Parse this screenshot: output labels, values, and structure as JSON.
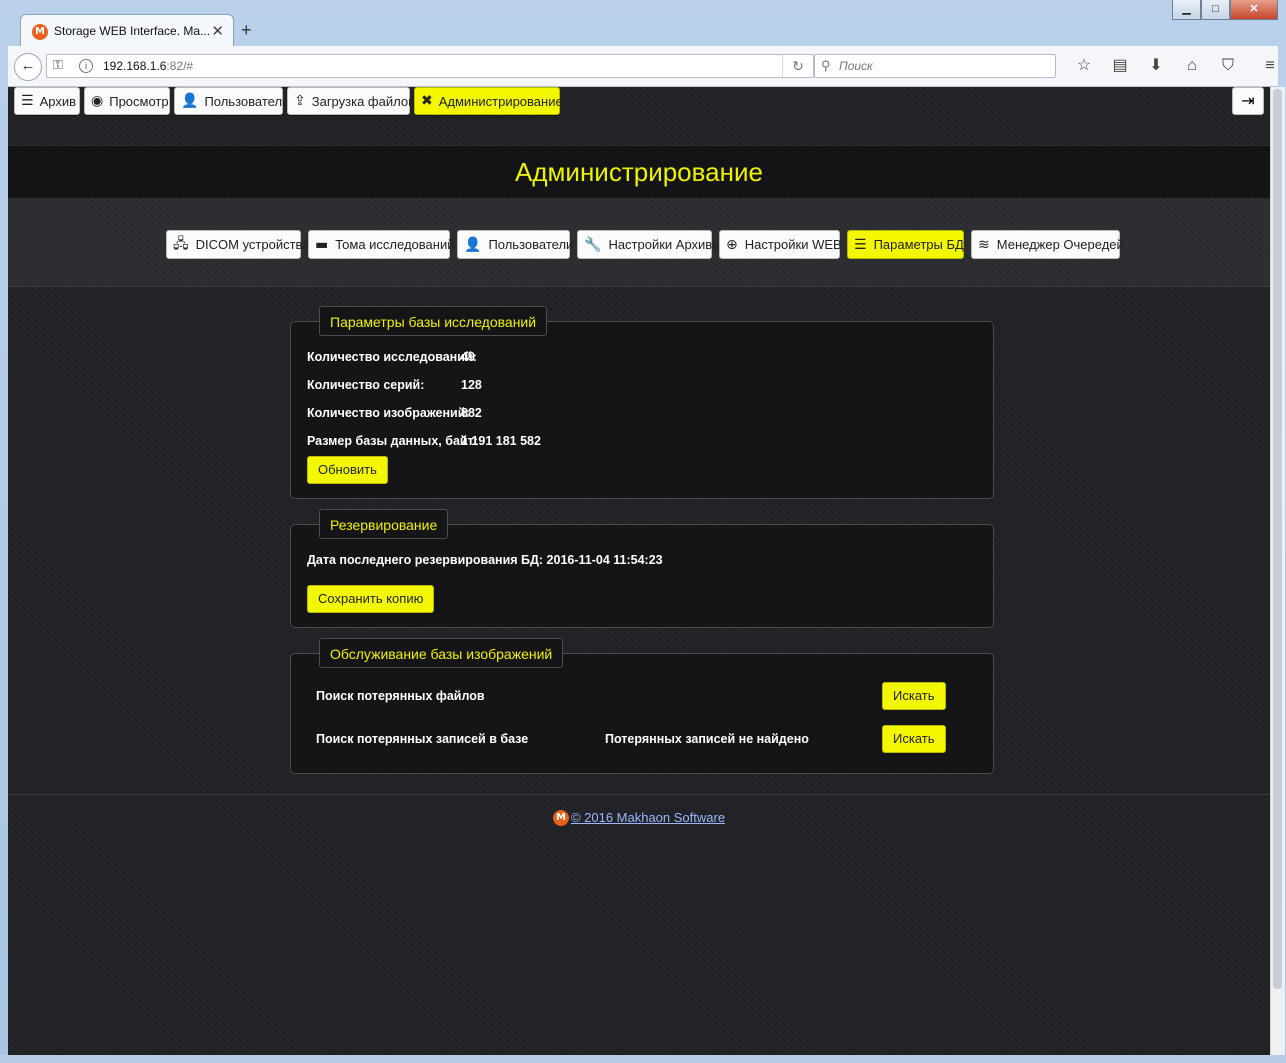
{
  "browser": {
    "tab_title": "Storage WEB Interface. Ma...",
    "tab_favicon": "М",
    "url_host": "192.168.1.6",
    "url_rest": ":82/#",
    "search_placeholder": "Поиск"
  },
  "top_nav": {
    "items": [
      {
        "label": "Архив",
        "icon": "list-icon",
        "glyph": "☰"
      },
      {
        "label": "Просмотр",
        "icon": "eye-icon",
        "glyph": "◉"
      },
      {
        "label": "Пользователь",
        "icon": "user-icon",
        "glyph": "👤"
      },
      {
        "label": "Загрузка файлов",
        "icon": "upload-icon",
        "glyph": "⇪"
      },
      {
        "label": "Администрирование",
        "icon": "tools-icon",
        "glyph": "✖"
      }
    ],
    "active": "Администрирование",
    "logout_icon": "logout-icon"
  },
  "page": {
    "title": "Администрирование"
  },
  "sub_nav": {
    "items": [
      {
        "label": "DICOM устройства",
        "icon": "network-icon",
        "glyph": "🖧"
      },
      {
        "label": "Тома исследований",
        "icon": "folder-icon",
        "glyph": "▬"
      },
      {
        "label": "Пользователи",
        "icon": "users-icon",
        "glyph": "👤"
      },
      {
        "label": "Настройки Архива",
        "icon": "wrench-icon",
        "glyph": "🔧"
      },
      {
        "label": "Настройки WEB",
        "icon": "globe-icon",
        "glyph": "⊕"
      },
      {
        "label": "Параметры БД",
        "icon": "database-icon",
        "glyph": "☰"
      },
      {
        "label": "Менеджер Очередей",
        "icon": "layers-icon",
        "glyph": "≋"
      }
    ],
    "active": "Параметры БД"
  },
  "db_params": {
    "legend": "Параметры базы исследований",
    "rows": [
      {
        "label": "Количество исследований:",
        "value": "49"
      },
      {
        "label": "Количество серий:",
        "value": "128"
      },
      {
        "label": "Количество изображений:",
        "value": "882"
      },
      {
        "label": "Размер базы данных, байт:",
        "value": "1 191 181 582"
      }
    ],
    "refresh_label": "Обновить"
  },
  "backup": {
    "legend": "Резервирование",
    "last_backup_text": "Дата последнего резервирования БД: 2016-11-04 11:54:23",
    "save_label": "Сохранить копию"
  },
  "maintenance": {
    "legend": "Обслуживание базы изображений",
    "lost_files_label": "Поиск потерянных файлов",
    "lost_files_status": "",
    "lost_records_label": "Поиск потерянных записей в базе",
    "lost_records_status": "Потерянных записей не найдено",
    "search_label": "Искать"
  },
  "footer": {
    "logo_text": "М",
    "copyright": "© 2016 Makhaon Software"
  },
  "colors": {
    "accent": "#f3f800",
    "title": "#eef200",
    "background": "#1f2124",
    "link": "#9cb6ff"
  }
}
